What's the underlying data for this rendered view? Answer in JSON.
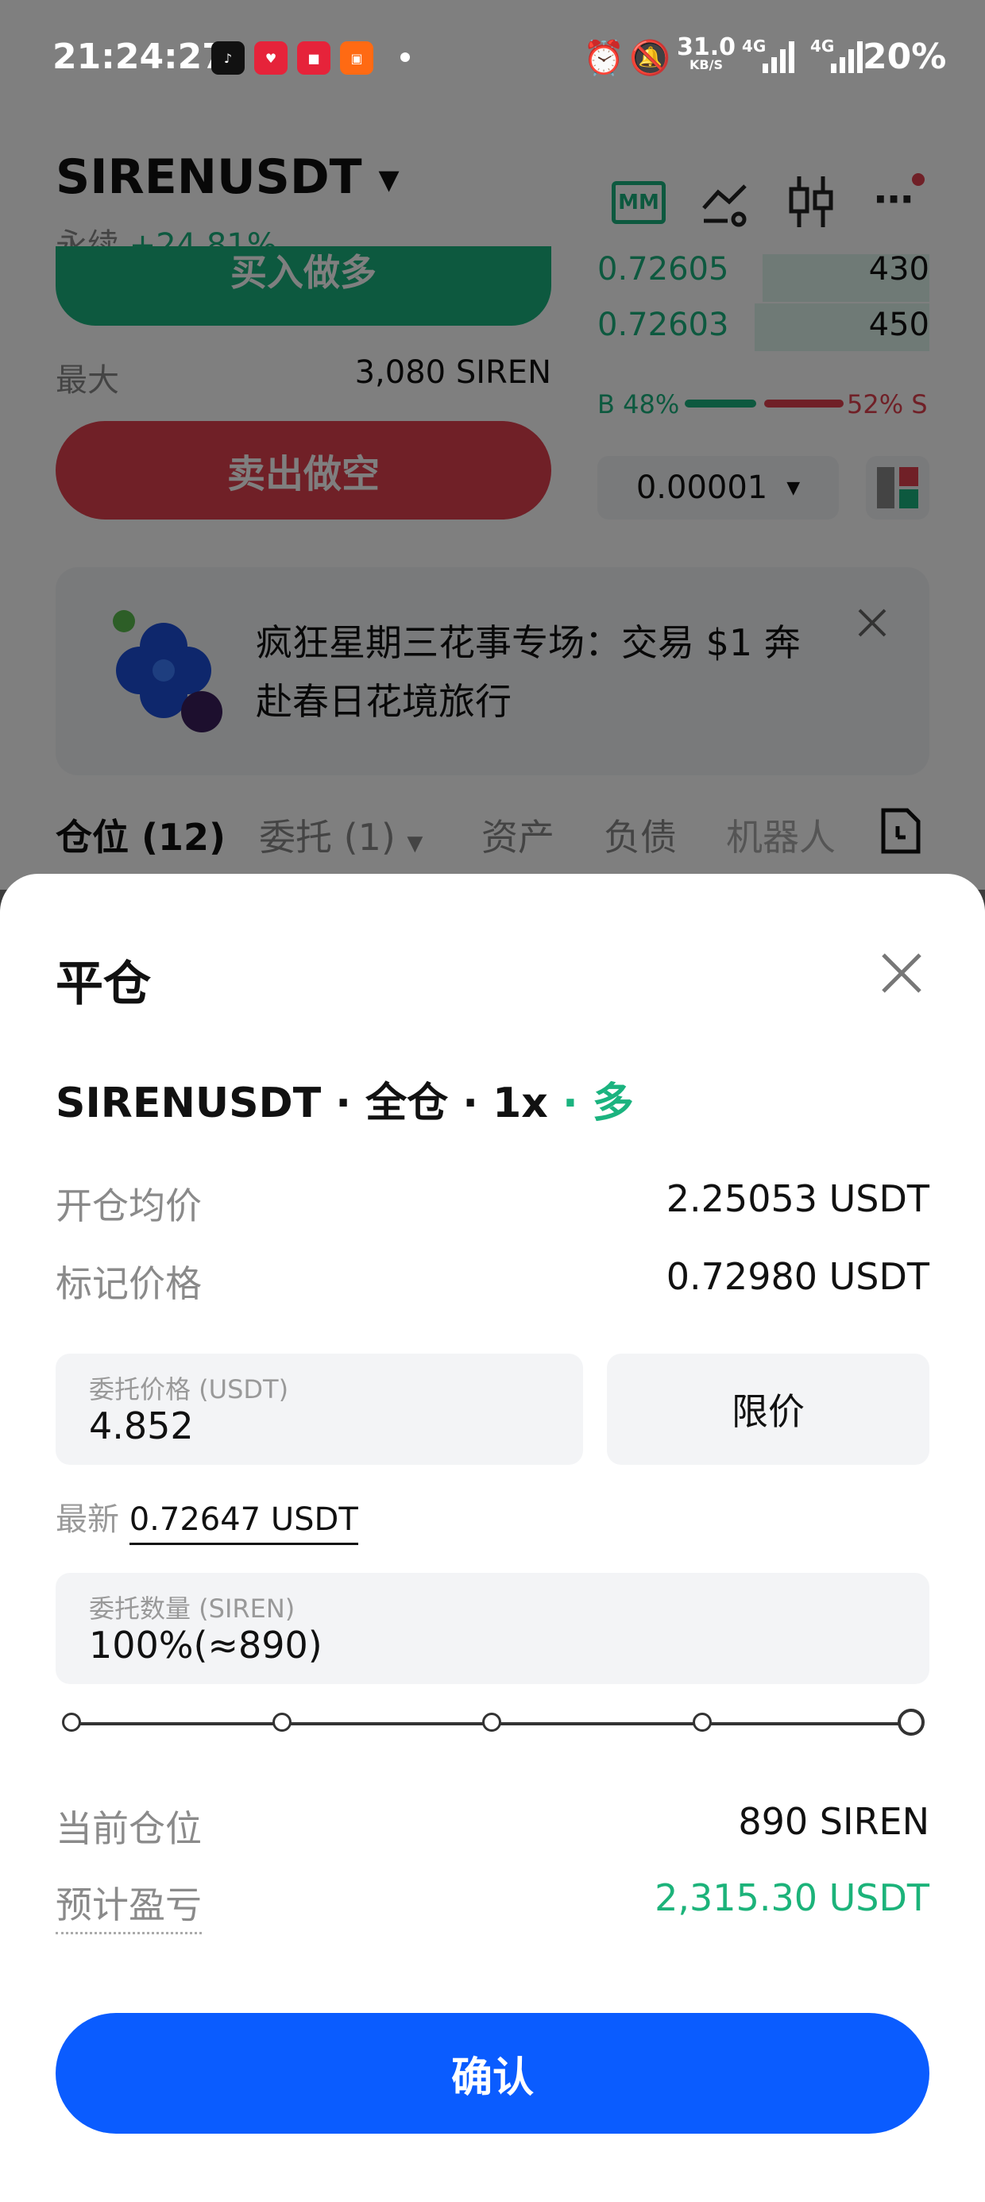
{
  "status_bar": {
    "time": "21:24:27",
    "net_speed": "31.0",
    "net_unit": "KB/S",
    "net_type_1": "4G",
    "net_type_2": "4G",
    "battery": "20%"
  },
  "header": {
    "symbol": "SIRENUSDT",
    "type_label": "永续",
    "change": "+24.81%",
    "mm_label": "MM"
  },
  "trade": {
    "buy_label": "买入做多",
    "max_label": "最大",
    "max_value": "3,080 SIREN",
    "sell_label": "卖出做空"
  },
  "orderbook": {
    "rows": [
      {
        "price": "0.72605",
        "amount": "430"
      },
      {
        "price": "0.72603",
        "amount": "450"
      }
    ],
    "buy_ratio": "B 48%",
    "sell_ratio": "52% S",
    "precision": "0.00001"
  },
  "banner": {
    "text_line1": "疯狂星期三花事专场：交易 $1 奔",
    "text_line2": "赴春日花境旅行"
  },
  "tabs": [
    {
      "label": "仓位 (12)"
    },
    {
      "label": "委托 (1)"
    },
    {
      "label": "资产"
    },
    {
      "label": "负债"
    },
    {
      "label": "机器人"
    }
  ],
  "sheet": {
    "title": "平仓",
    "position_symbol": "SIRENUSDT · 全仓 · 1x",
    "position_side": "· 多",
    "avg_price_label": "开仓均价",
    "avg_price_value": "2.25053 USDT",
    "mark_price_label": "标记价格",
    "mark_price_value": "0.72980 USDT",
    "order_price_label": "委托价格 (USDT)",
    "order_price_value": "4.852",
    "order_type": "限价",
    "latest_label": "最新",
    "latest_value": "0.72647 USDT",
    "qty_label": "委托数量 (SIREN)",
    "qty_value": "100%(≈890)",
    "slider_percent": 100,
    "current_pos_label": "当前仓位",
    "current_pos_value": "890 SIREN",
    "pnl_label": "预计盈亏",
    "pnl_value": "2,315.30 USDT",
    "confirm_label": "确认"
  },
  "colors": {
    "green": "#1bb37f",
    "red": "#e0404f",
    "blue": "#0a5cff",
    "pnl_green": "#1cb37a"
  }
}
